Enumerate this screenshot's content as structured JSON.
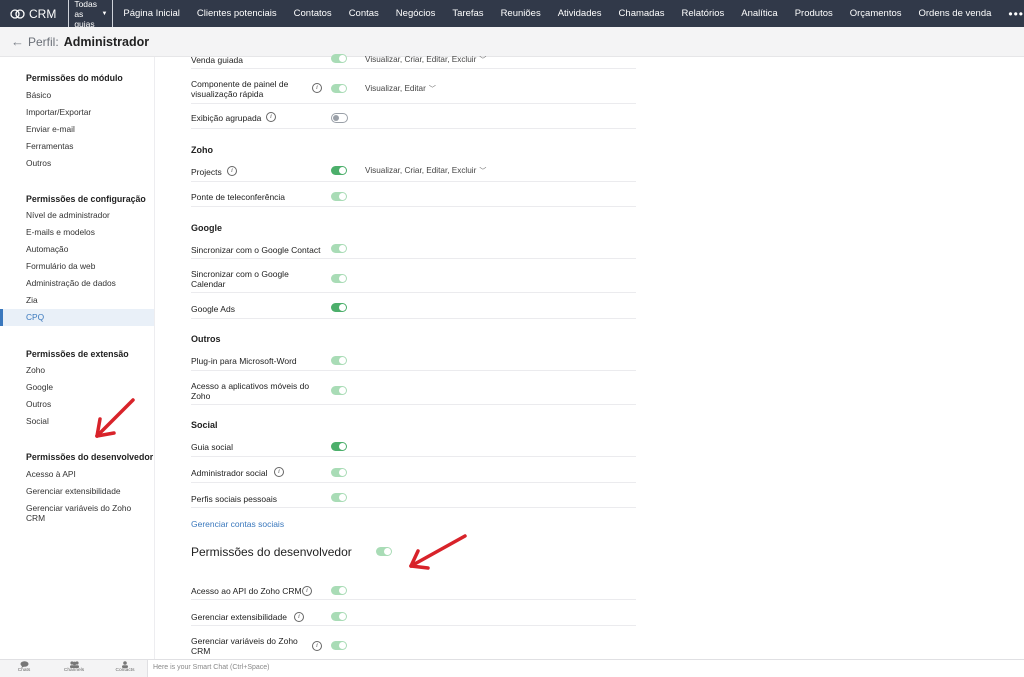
{
  "topnav": {
    "brand": "CRM",
    "all_modules": "Todas as guias",
    "tabs": [
      "Página Inicial",
      "Clientes potenciais",
      "Contatos",
      "Contas",
      "Negócios",
      "Tarefas",
      "Reuniões",
      "Atividades",
      "Chamadas",
      "Relatórios",
      "Analítica",
      "Produtos",
      "Orçamentos",
      "Ordens de venda"
    ],
    "more": "•••"
  },
  "header": {
    "back_label": "Perfil:",
    "title": "Administrador"
  },
  "sidebar": {
    "module_heading": "Permissões do módulo",
    "module_items": [
      "Básico",
      "Importar/Exportar",
      "Enviar e-mail",
      "Ferramentas",
      "Outros"
    ],
    "setup_heading": "Permissões de configuração",
    "setup_items": [
      "Nível de administrador",
      "E-mails e modelos",
      "Automação",
      "Formulário da web",
      "Administração de dados",
      "Zia",
      "CPQ"
    ],
    "extension_heading": "Permissões de extensão",
    "extension_items": [
      "Zoho",
      "Google",
      "Outros",
      "Social"
    ],
    "developer_heading": "Permissões do desenvolvedor",
    "developer_items": [
      "Acesso à API",
      "Gerenciar extensibilidade",
      "Gerenciar variáveis do Zoho CRM"
    ]
  },
  "main": {
    "rows_top": [
      {
        "label": "Venda guiada",
        "perm": "Visualizar, Criar, Editar, Excluir"
      },
      {
        "label": "Componente de painel de visualização rápida",
        "perm": "Visualizar, Editar"
      },
      {
        "label": "Exibição agrupada"
      }
    ],
    "zoho_heading": "Zoho",
    "zoho_rows": [
      {
        "label": "Projects",
        "perm": "Visualizar, Criar, Editar, Excluir"
      },
      {
        "label": "Ponte de teleconferência"
      }
    ],
    "google_heading": "Google",
    "google_rows": [
      {
        "label": "Sincronizar com o Google Contact"
      },
      {
        "label": "Sincronizar com o Google Calendar"
      },
      {
        "label": "Google Ads"
      }
    ],
    "outros_heading": "Outros",
    "outros_rows": [
      {
        "label": "Plug-in para Microsoft-Word"
      },
      {
        "label": "Acesso a aplicativos móveis do Zoho"
      }
    ],
    "social_heading": "Social",
    "social_rows": [
      {
        "label": "Guia social"
      },
      {
        "label": "Administrador social"
      },
      {
        "label": "Perfis sociais pessoais"
      }
    ],
    "social_link": "Gerenciar contas sociais",
    "developer_heading": "Permissões do desenvolvedor",
    "developer_rows": [
      {
        "label": "Acesso ao API do Zoho CRM"
      },
      {
        "label": "Gerenciar extensibilidade"
      },
      {
        "label": "Gerenciar variáveis do Zoho CRM"
      }
    ]
  },
  "bottombar": {
    "items": [
      "Chats",
      "Channels",
      "Contacts"
    ],
    "chat_placeholder": "Here is your Smart Chat (Ctrl+Space)"
  },
  "colors": {
    "nav_bg": "#313949",
    "toggle_on": "#4caf6b",
    "toggle_disabled": "#a9dcb6",
    "link": "#3a78bd",
    "arrow": "#d8232a"
  }
}
